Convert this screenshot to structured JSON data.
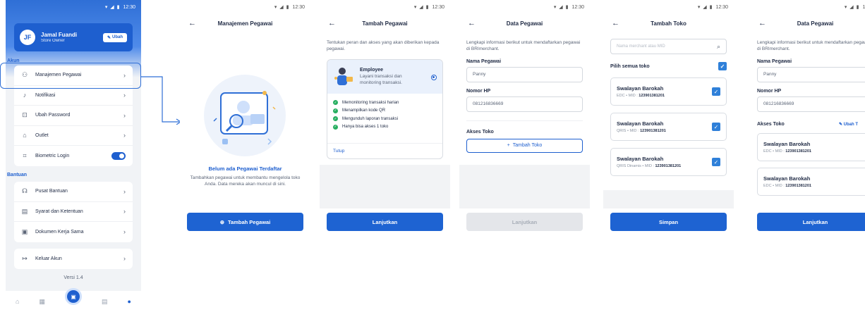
{
  "status": {
    "time": "12:30"
  },
  "profile": {
    "initials": "JF",
    "name": "Jamal Fuandi",
    "role": "Store Owner",
    "edit_label": "Ubah",
    "section_akun": "Akun",
    "akun_items": [
      {
        "label": "Manajemen Pegawai",
        "icon": "users-icon"
      },
      {
        "label": "Notifikasi",
        "icon": "bell-icon"
      },
      {
        "label": "Ubah Password",
        "icon": "lock-icon"
      },
      {
        "label": "Outlet",
        "icon": "store-icon"
      },
      {
        "label": "Biometric Login",
        "icon": "fingerprint-icon",
        "toggle": true
      }
    ],
    "section_bantuan": "Bantuan",
    "bantuan_items": [
      {
        "label": "Pusat Bantuan",
        "icon": "headset-icon"
      },
      {
        "label": "Syarat dan Ketentuan",
        "icon": "document-icon"
      },
      {
        "label": "Dokumen Kerja Sama",
        "icon": "contract-icon"
      }
    ],
    "logout_label": "Keluar Akun",
    "version": "Versi 1.4"
  },
  "manajemen": {
    "title": "Manajemen Pegawai",
    "empty_title": "Belum ada Pegawai Terdaftar",
    "empty_desc": "Tambahkan pegawai untuk membantu mengelola toko Anda. Data mereka akan muncul di sini.",
    "button": "Tambah Pegawai"
  },
  "tambah_pegawai": {
    "title": "Tambah Pegawai",
    "intro": "Tentukan peran dan akses yang akan diberikan kepada pegawai.",
    "role_name": "Employee",
    "role_desc": "Layani transaksi dan monitoring transaksi.",
    "permissions": [
      "Memonitoring transaksi harian",
      "Menampilkan kode QR",
      "Mengunduh laporan transaksi",
      "Hanya bisa akses 1 toko"
    ],
    "close_label": "Tutup",
    "button": "Lanjutkan"
  },
  "data_pegawai": {
    "title": "Data Pegawai",
    "intro": "Lengkapi informasi berikut untuk mendaftarkan pegawai di BRImerchant.",
    "name_label": "Nama Pegawai",
    "name_value": "Panny",
    "phone_label": "Nomor HP",
    "phone_value": "081216836669",
    "akses_label": "Akses Toko",
    "add_store_label": "Tambah Toko",
    "button": "Lanjutkan"
  },
  "tambah_toko": {
    "title": "Tambah Toko",
    "search_placeholder": "Nama merchant atau MID",
    "select_all": "Pilih semua toko",
    "stores": [
      {
        "name": "Swalayan Barokah",
        "type": "EDC",
        "mid_label": "MID :",
        "mid": "123901381201"
      },
      {
        "name": "Swalayan Barokah",
        "type": "QRIS",
        "mid_label": "MID :",
        "mid": "123901381201"
      },
      {
        "name": "Swalayan Barokah",
        "type": "QRIS Dinamis",
        "mid_label": "MID :",
        "mid": "123901381201"
      }
    ],
    "button": "Simpan"
  },
  "data_pegawai_2": {
    "title": "Data Pegawai",
    "intro": "Lengkapi informasi berikut untuk mendaftarkan pegawai di BRImerchant.",
    "name_label": "Nama Pegawai",
    "name_value": "Panny",
    "phone_label": "Nomor HP",
    "phone_value": "081216836669",
    "akses_label": "Akses Toko",
    "edit_store_label": "Ubah T",
    "stores": [
      {
        "name": "Swalayan Barokah",
        "type": "EDC",
        "mid_label": "MID :",
        "mid": "123901381201"
      },
      {
        "name": "Swalayan Barokah",
        "type": "EDC",
        "mid_label": "MID :",
        "mid": "123901381201"
      }
    ],
    "button": "Lanjutkan"
  },
  "colors": {
    "primary": "#1e63d2",
    "accent_green": "#27ae60"
  }
}
